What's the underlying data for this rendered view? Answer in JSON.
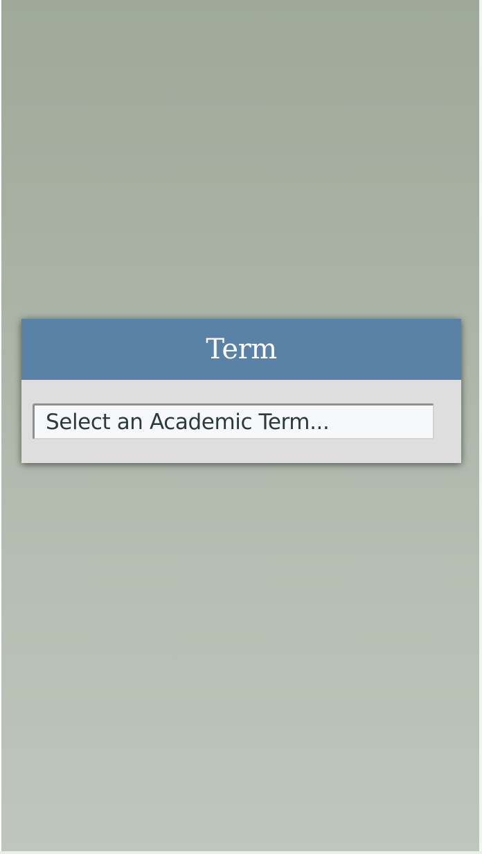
{
  "term_panel": {
    "title": "Term",
    "select": {
      "placeholder": "Select an Academic Term..."
    }
  },
  "colors": {
    "header": "#5a82a6",
    "panel": "#dedede",
    "background_top": "#9ea999",
    "background_bottom": "#bfc6bc",
    "select_text": "#2d3a3a"
  }
}
